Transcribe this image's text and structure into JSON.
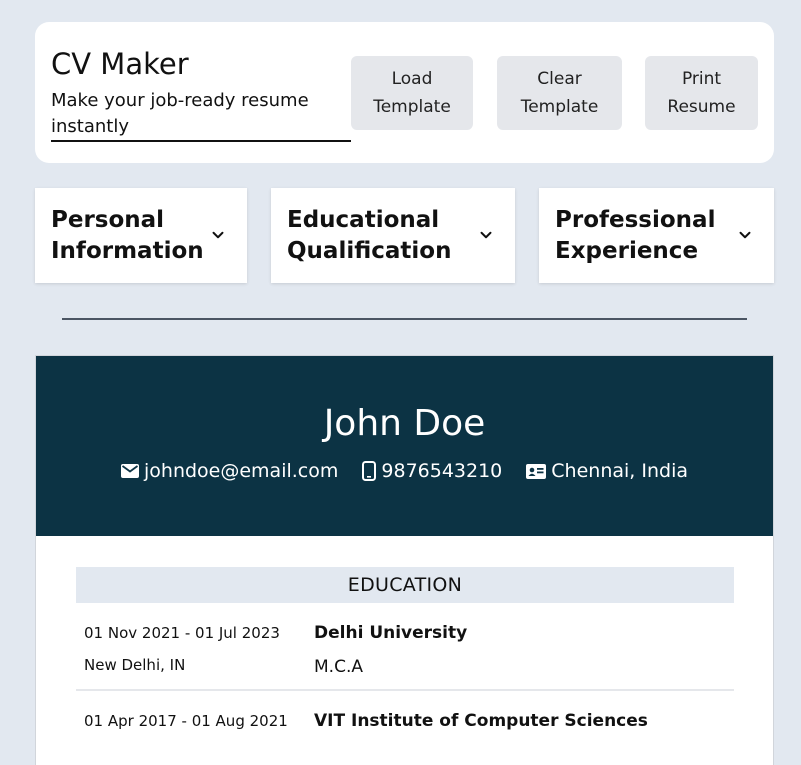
{
  "brand": {
    "title": "CV Maker",
    "subtitle": "Make your job-ready resume instantly"
  },
  "header_buttons": {
    "load": "Load Template",
    "clear": "Clear Template",
    "print": "Print Resume"
  },
  "accordions": [
    {
      "label": "Personal Information",
      "icon": "chevron-down-icon"
    },
    {
      "label": "Educational Qualification",
      "icon": "chevron-down-icon"
    },
    {
      "label": "Professional Experience",
      "icon": "chevron-down-icon"
    }
  ],
  "resume": {
    "name": "John Doe",
    "email": "johndoe@email.com",
    "phone": "9876543210",
    "location": "Chennai, India",
    "header_color": "#0c3344",
    "education": {
      "title": "EDUCATION",
      "entries": [
        {
          "dates": "01 Nov 2021 - 01 Jul 2023",
          "location": "New Delhi, IN",
          "institution": "Delhi University",
          "degree": "M.C.A"
        },
        {
          "dates": "01 Apr 2017 - 01 Aug 2021",
          "location": "",
          "institution": "VIT Institute of Computer Sciences",
          "degree": ""
        }
      ]
    }
  }
}
